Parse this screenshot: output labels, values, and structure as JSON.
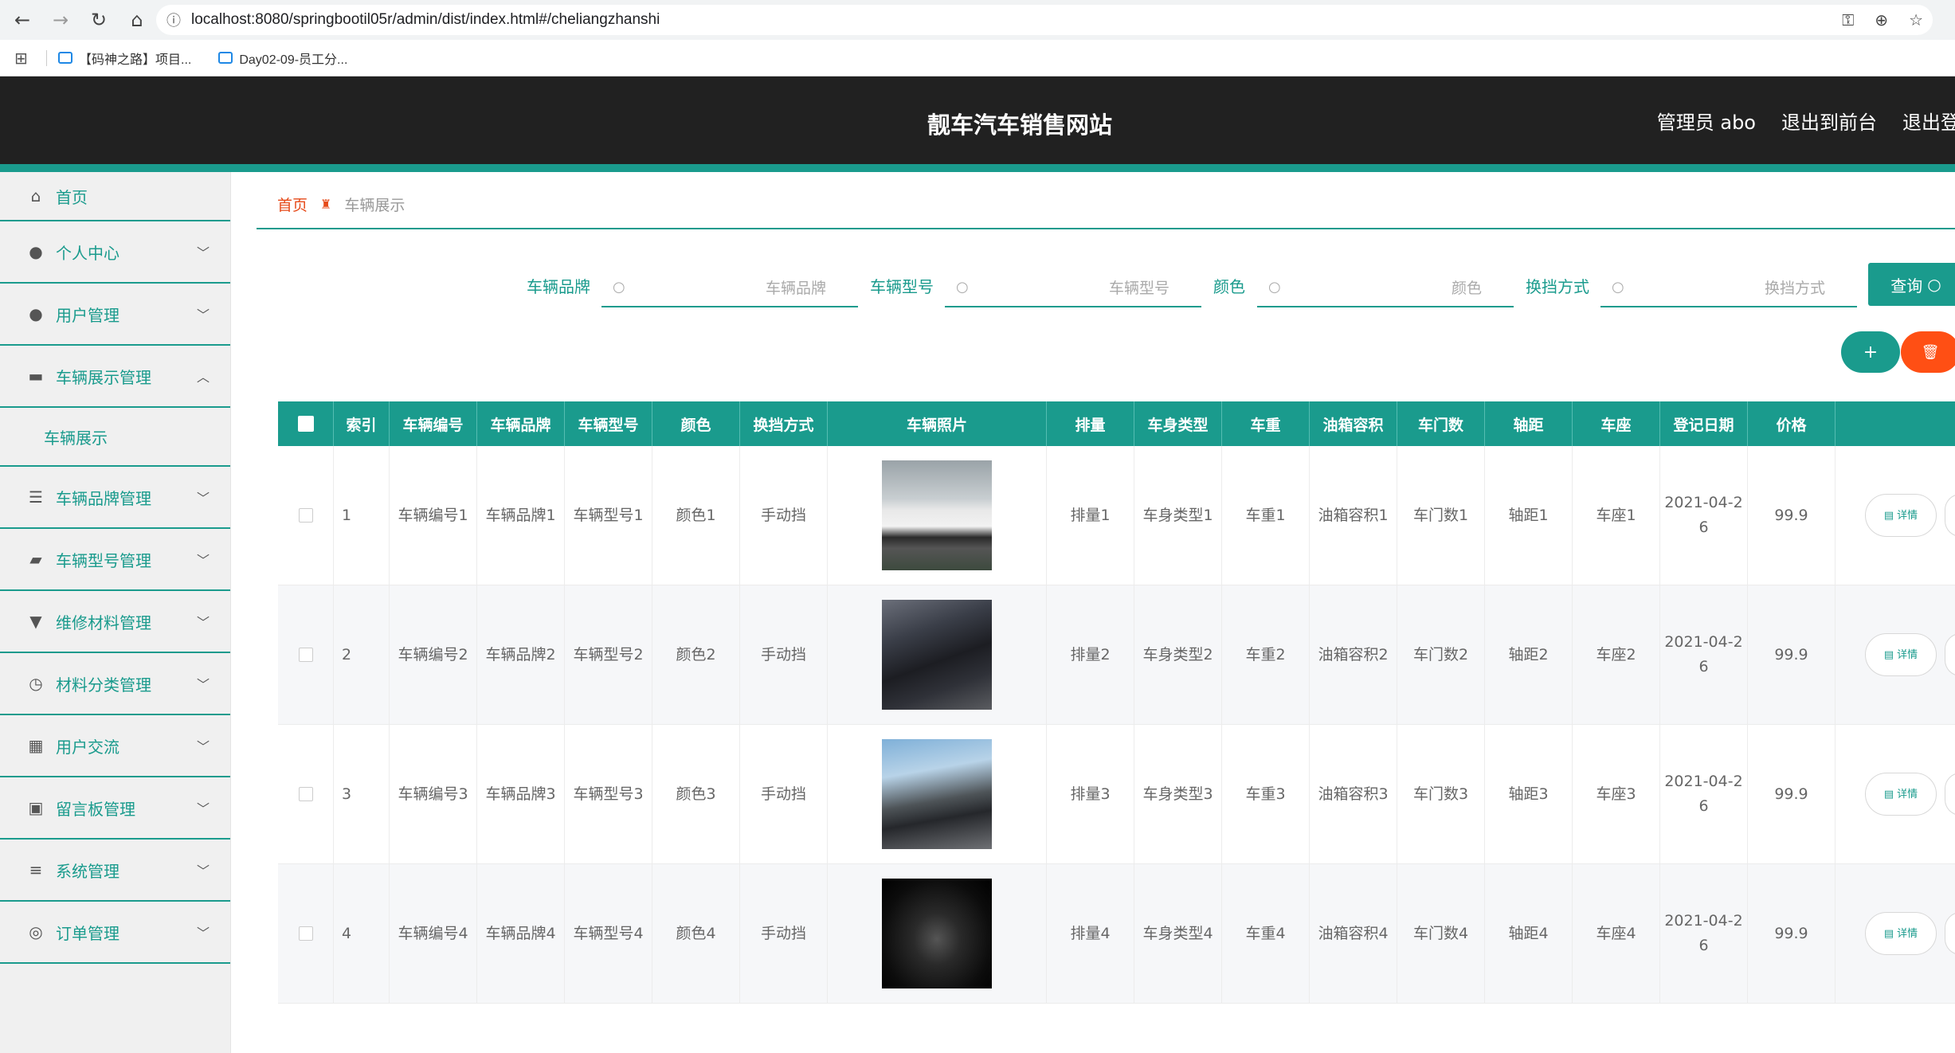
{
  "browser": {
    "url": "localhost:8080/springbootil05r/admin/dist/index.html#/cheliangzhanshi",
    "bookmarks": [
      "【码神之路】项目...",
      "Day02-09-员工分..."
    ]
  },
  "header": {
    "title": "靓车汽车销售网站",
    "links": [
      "管理员 abo",
      "退出到前台",
      "退出登录"
    ]
  },
  "sidebar": {
    "items": [
      {
        "label": "首页",
        "icon": "home-icon",
        "glyph": "⌂"
      },
      {
        "label": "个人中心",
        "icon": "user-icon",
        "glyph": "●"
      },
      {
        "label": "用户管理",
        "icon": "user-icon",
        "glyph": "●"
      },
      {
        "label": "车辆展示管理",
        "icon": "monitor-icon",
        "glyph": "▬"
      },
      {
        "label": "车辆展示",
        "icon": "",
        "glyph": ""
      },
      {
        "label": "车辆品牌管理",
        "icon": "sliders-icon",
        "glyph": "☰"
      },
      {
        "label": "车辆型号管理",
        "icon": "wallet-icon",
        "glyph": "▰"
      },
      {
        "label": "维修材料管理",
        "icon": "brush-icon",
        "glyph": "▼"
      },
      {
        "label": "材料分类管理",
        "icon": "clock-icon",
        "glyph": "◷"
      },
      {
        "label": "用户交流",
        "icon": "grid-icon",
        "glyph": "▦"
      },
      {
        "label": "留言板管理",
        "icon": "camera-icon",
        "glyph": "▣"
      },
      {
        "label": "系统管理",
        "icon": "menu-icon",
        "glyph": "≡"
      },
      {
        "label": "订单管理",
        "icon": "compass-icon",
        "glyph": "◎"
      }
    ]
  },
  "breadcrumb": {
    "home": "首页",
    "current": "车辆展示"
  },
  "search": {
    "fields": [
      {
        "label": "车辆品牌",
        "placeholder": "车辆品牌"
      },
      {
        "label": "车辆型号",
        "placeholder": "车辆型号"
      },
      {
        "label": "颜色",
        "placeholder": "颜色"
      },
      {
        "label": "换挡方式",
        "placeholder": "换挡方式"
      }
    ],
    "query_label": "查询"
  },
  "actions": {
    "add": "+",
    "delete": "🗑"
  },
  "table": {
    "headers": [
      "索引",
      "车辆编号",
      "车辆品牌",
      "车辆型号",
      "颜色",
      "换挡方式",
      "车辆照片",
      "排量",
      "车身类型",
      "车重",
      "油箱容积",
      "车门数",
      "轴距",
      "车座",
      "登记日期",
      "价格"
    ],
    "detail_label": "详情",
    "rows": [
      {
        "index": "1",
        "code": "车辆编号1",
        "brand": "车辆品牌1",
        "model": "车辆型号1",
        "color": "颜色1",
        "gear": "手动挡",
        "displacement": "排量1",
        "body": "车身类型1",
        "weight": "车重1",
        "tank": "油箱容积1",
        "doors": "车门数1",
        "wheelbase": "轴距1",
        "seats": "车座1",
        "date": "2021-04-26",
        "price": "99.9"
      },
      {
        "index": "2",
        "code": "车辆编号2",
        "brand": "车辆品牌2",
        "model": "车辆型号2",
        "color": "颜色2",
        "gear": "手动挡",
        "displacement": "排量2",
        "body": "车身类型2",
        "weight": "车重2",
        "tank": "油箱容积2",
        "doors": "车门数2",
        "wheelbase": "轴距2",
        "seats": "车座2",
        "date": "2021-04-26",
        "price": "99.9"
      },
      {
        "index": "3",
        "code": "车辆编号3",
        "brand": "车辆品牌3",
        "model": "车辆型号3",
        "color": "颜色3",
        "gear": "手动挡",
        "displacement": "排量3",
        "body": "车身类型3",
        "weight": "车重3",
        "tank": "油箱容积3",
        "doors": "车门数3",
        "wheelbase": "轴距3",
        "seats": "车座3",
        "date": "2021-04-26",
        "price": "99.9"
      },
      {
        "index": "4",
        "code": "车辆编号4",
        "brand": "车辆品牌4",
        "model": "车辆型号4",
        "color": "颜色4",
        "gear": "手动挡",
        "displacement": "排量4",
        "body": "车身类型4",
        "weight": "车重4",
        "tank": "油箱容积4",
        "doors": "车门数4",
        "wheelbase": "轴距4",
        "seats": "车座4",
        "date": "2021-04-26",
        "price": "99.9"
      }
    ]
  }
}
